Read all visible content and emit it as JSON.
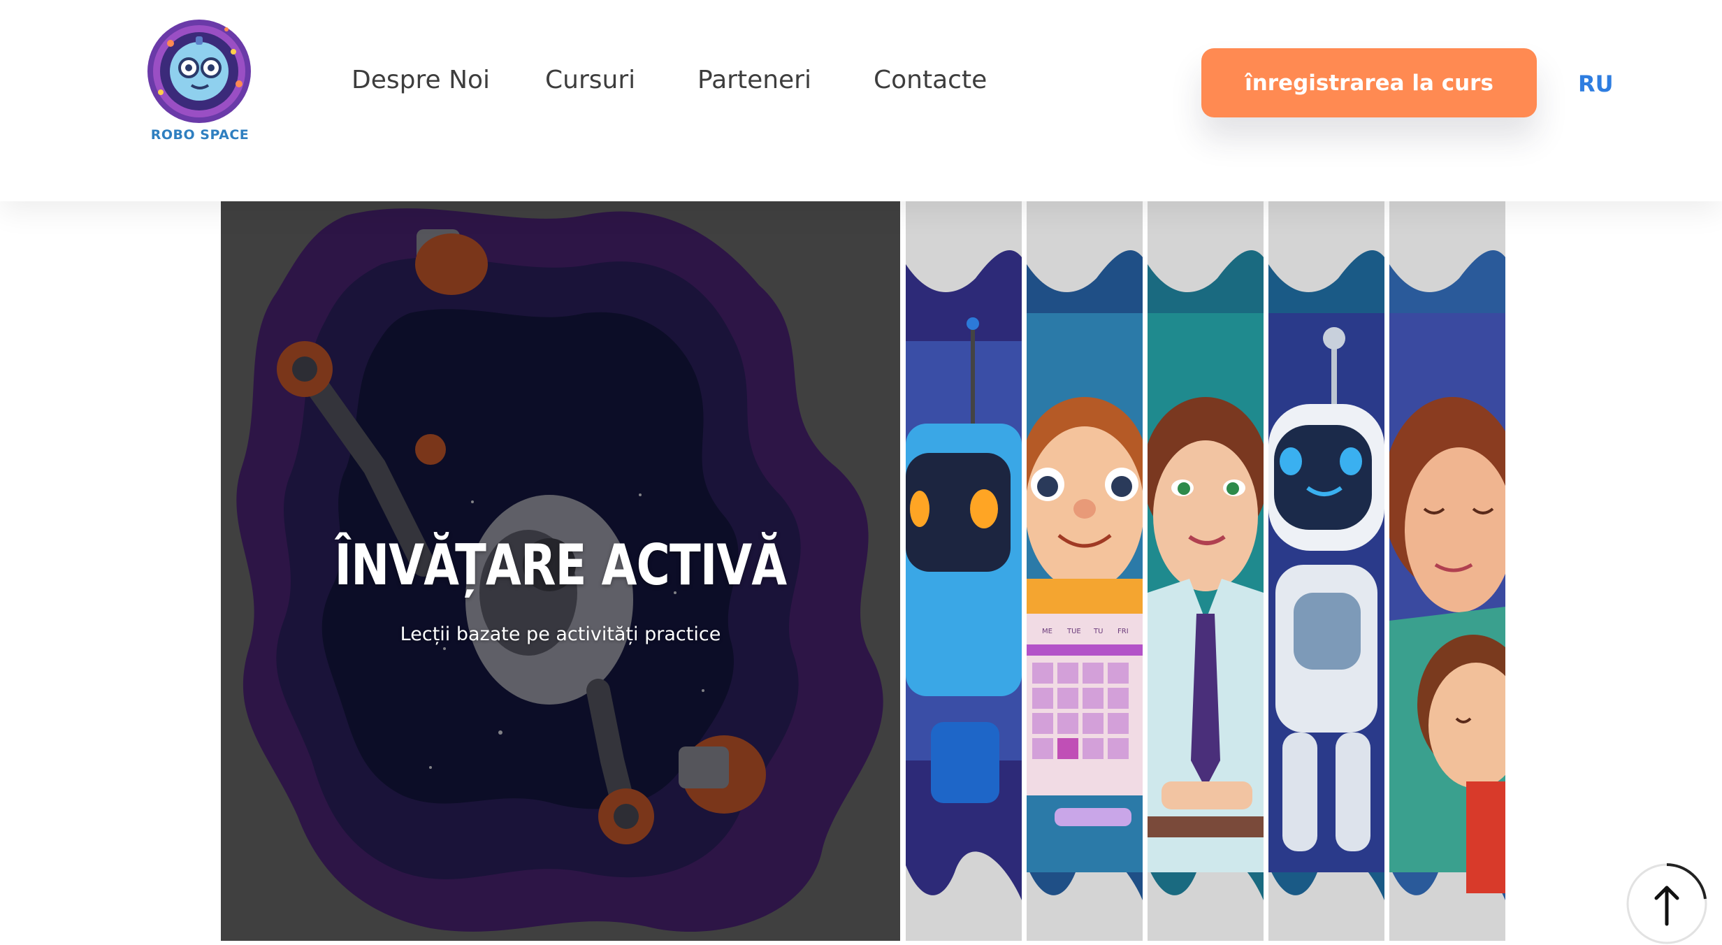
{
  "header": {
    "logo_text": "ROBO SPACE",
    "nav": [
      "Despre Noi",
      "Cursuri",
      "Parteneri",
      "Contacte"
    ],
    "cta_label": "înregistrarea la curs",
    "lang_label": "RU"
  },
  "hero": {
    "title": "ÎNVĂȚARE ACTIVĂ",
    "subtitle": "Lecții bazate pe activități practice"
  },
  "slides": [
    {
      "name": "robot-blue"
    },
    {
      "name": "boy-student"
    },
    {
      "name": "teacher-woman"
    },
    {
      "name": "robot-white"
    },
    {
      "name": "mother-child"
    }
  ],
  "calendar_labels": [
    "ME",
    "TUE",
    "TU",
    "FRI"
  ],
  "colors": {
    "accent_orange": "#ff8a52",
    "lang_blue": "#2e7de0",
    "logo_blue": "#2f7fc0"
  }
}
